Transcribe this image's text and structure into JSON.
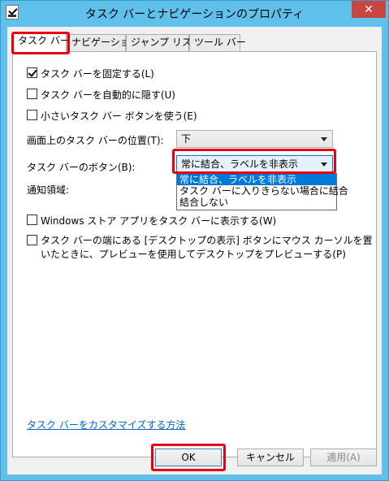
{
  "window": {
    "title": "タスク バーとナビゲーションのプロパティ",
    "close_glyph": "✕"
  },
  "tabs": [
    {
      "label": "タスク バー",
      "active": true
    },
    {
      "label": "ナビゲーション",
      "active": false
    },
    {
      "label": "ジャンプ リスト",
      "active": false
    },
    {
      "label": "ツール バー",
      "active": false
    }
  ],
  "options": {
    "lock": {
      "label": "タスク バーを固定する(L)",
      "checked": true
    },
    "autohide": {
      "label": "タスク バーを自動的に隠す(U)",
      "checked": false
    },
    "small_buttons": {
      "label": "小さいタスク バー ボタンを使う(E)",
      "checked": false
    }
  },
  "location": {
    "label": "画面上のタスク バーの位置(T):",
    "value": "下"
  },
  "buttons_combine": {
    "label": "タスク バーのボタン(B):",
    "value": "常に結合、ラベルを非表示",
    "options": [
      "常に結合、ラベルを非表示",
      "タスク バーに入りきらない場合に結合",
      "結合しない"
    ]
  },
  "notification": {
    "label": "通知領域:"
  },
  "store_apps": {
    "label": "Windows ストア アプリをタスク バーに表示する(W)",
    "checked": false
  },
  "peek": {
    "label": "タスク バーの端にある [デスクトップの表示] ボタンにマウス カーソルを置いたときに、プレビューを使用してデスクトップをプレビューする(P)",
    "checked": false
  },
  "customize_link": "タスク バーをカスタマイズする方法",
  "footer": {
    "ok": "OK",
    "cancel": "キャンセル",
    "apply": "適用(A)"
  },
  "colors": {
    "titlebar": "#5fc0ea",
    "highlight_box": "#e60012",
    "selection": "#0078d7",
    "link": "#0066cc"
  }
}
